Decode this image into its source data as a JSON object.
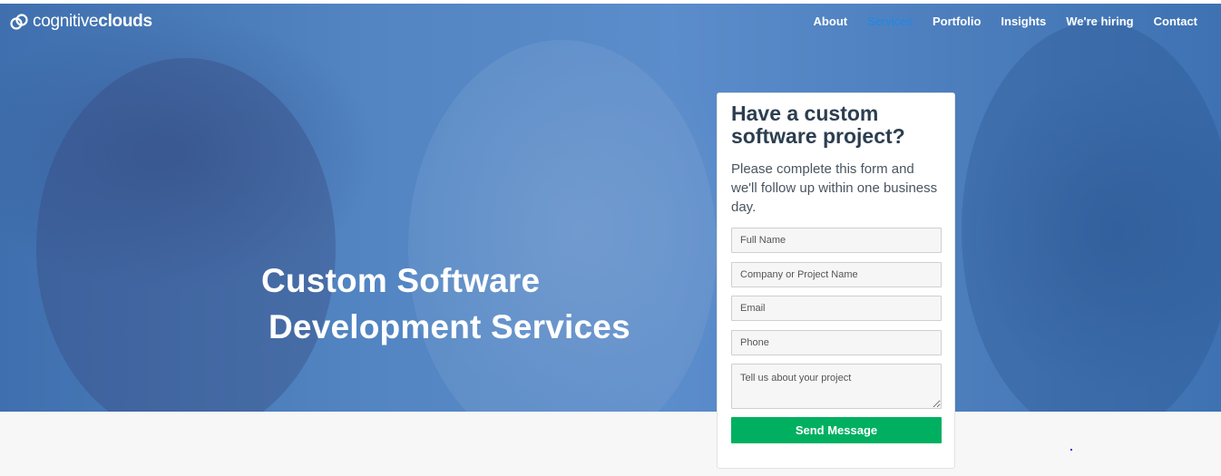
{
  "header": {
    "logo_text_light": "cognitive",
    "logo_text_bold": "clouds",
    "logo_icon": "cloud-logo-icon"
  },
  "nav": {
    "items": [
      {
        "label": "About"
      },
      {
        "label": "Services",
        "active": true
      },
      {
        "label": "Portfolio"
      },
      {
        "label": "Insights"
      },
      {
        "label": "We're hiring"
      },
      {
        "label": "Contact"
      }
    ]
  },
  "hero": {
    "title_line1": "Custom Software",
    "title_line2": "Development Services",
    "overlay_color": "#4a7fc0"
  },
  "form": {
    "title": "Have a custom software project?",
    "subtitle": "Please complete this form and we'll follow up within one business day.",
    "fields": {
      "full_name_placeholder": "Full Name",
      "company_placeholder": "Company or Project Name",
      "email_placeholder": "Email",
      "phone_placeholder": "Phone",
      "project_placeholder": "Tell us about your project"
    },
    "submit_label": "Send Message",
    "submit_color": "#00b060"
  },
  "colors": {
    "nav_active": "#1e88e5",
    "form_title": "#2c3e50"
  }
}
